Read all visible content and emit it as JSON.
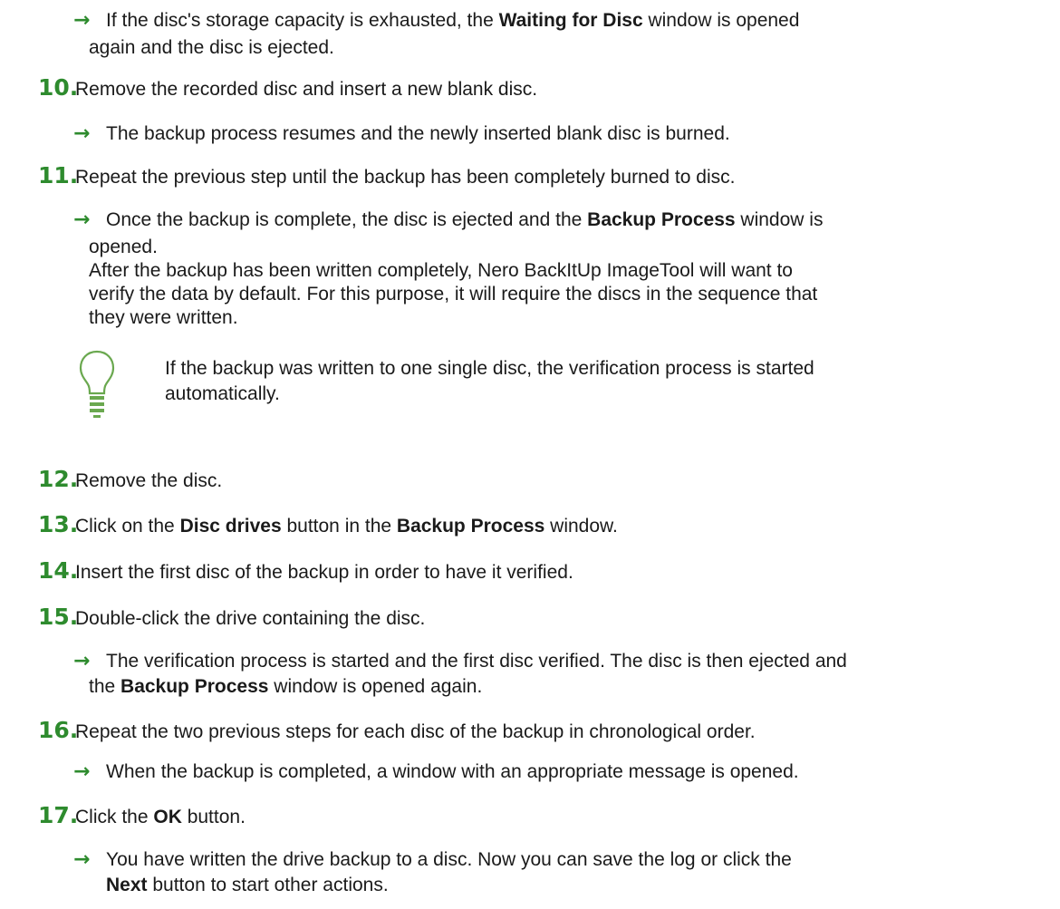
{
  "intro": {
    "arrow_glyph": "→",
    "line1_pre": "If the disc's storage capacity is exhausted, the ",
    "line1_bold": "Waiting for Disc",
    "line1_post": " window is opened",
    "line2": "again and the disc is ejected."
  },
  "steps": [
    {
      "num": "10.",
      "text": "Remove the recorded disc and insert a new blank disc.",
      "result": "The backup process resumes and the newly inserted blank disc is burned."
    },
    {
      "num": "11.",
      "text": "Repeat the previous step until the backup has been completely burned to disc.",
      "result_pre": "Once the backup is complete, the disc is ejected and the ",
      "result_bold": "Backup Process",
      "result_post": " window is",
      "result_line2": "opened.",
      "para_line1": "After the backup has been written completely, Nero BackItUp ImageTool will want to",
      "para_line2": "verify the data by default. For this purpose, it will require the discs in the sequence that",
      "para_line3": "they were written."
    },
    {
      "num": "12.",
      "text": "Remove the disc."
    },
    {
      "num": "13.",
      "text_pre": "Click on the ",
      "text_bold1": "Disc drives",
      "text_mid": " button in the ",
      "text_bold2": "Backup Process",
      "text_post": " window."
    },
    {
      "num": "14.",
      "text": "Insert the first disc of the backup in order to have it verified."
    },
    {
      "num": "15.",
      "text": "Double-click the drive containing the disc.",
      "result_line1": "The verification process is started and the first disc verified. The disc is then ejected and",
      "result_pre2": "the ",
      "result_bold2": "Backup Process",
      "result_post2": " window is opened again."
    },
    {
      "num": "16.",
      "text": "Repeat the two previous steps for each disc of the backup in chronological order.",
      "result": "When the backup is completed, a window with an appropriate message is opened."
    },
    {
      "num": "17.",
      "text_pre": "Click the ",
      "text_bold": "OK",
      "text_post": " button.",
      "result_line1": "You have written the drive backup to a disc. Now you can save the log or click the",
      "result_bold2": "Next",
      "result_post2": " button to start other actions."
    }
  ],
  "tip": {
    "icon": "lightbulb-icon",
    "line1": "If the backup was written to one single disc, the verification process is started",
    "line2": "automatically."
  },
  "colors": {
    "accent": "#2e8b2e",
    "text": "#1a1a1a",
    "tip_icon": "#6aa84f"
  }
}
